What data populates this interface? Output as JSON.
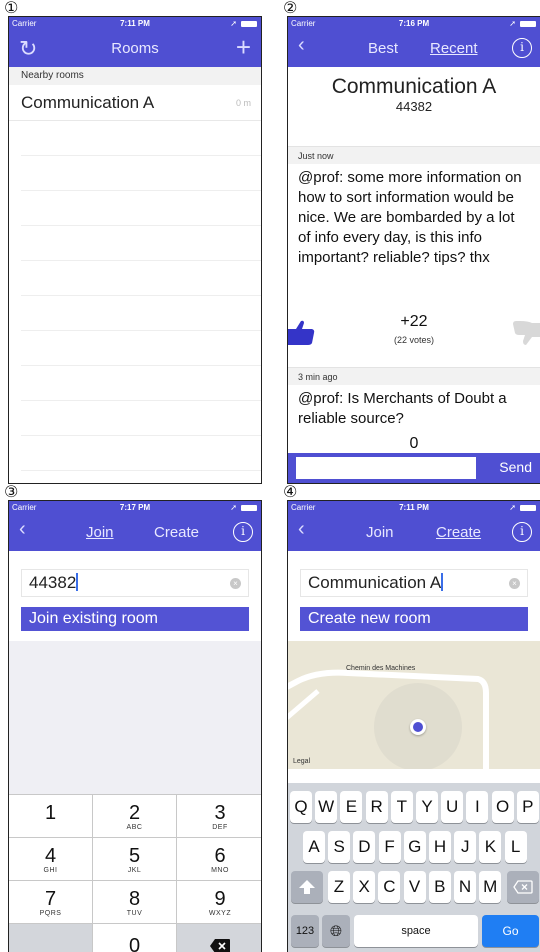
{
  "panels": {
    "p1": {
      "number": "①",
      "time": "7:11 PM",
      "title": "Rooms",
      "section": "Nearby rooms",
      "room": {
        "name": "Communication A",
        "distance": "0 m"
      }
    },
    "p2": {
      "number": "②",
      "time": "7:16 PM",
      "seg_best": "Best",
      "seg_recent": "Recent",
      "room_title": "Communication A",
      "room_code": "44382",
      "posts": [
        {
          "time": "Just now",
          "text": "@prof: some more information on how to sort information would be nice. We are bombarded by a lot of info every day, is this info important? reliable? tips? thx",
          "score": "+22",
          "votes": "(22 votes)"
        },
        {
          "time": "3 min ago",
          "text": "@prof: Is Merchants of Doubt a reliable source?",
          "score": "0"
        }
      ],
      "send_label": "Send"
    },
    "p3": {
      "number": "③",
      "time": "7:17 PM",
      "seg_join": "Join",
      "seg_create": "Create",
      "field_value": "44382",
      "action_label": "Join existing room",
      "keys": [
        {
          "d": "1",
          "l": ""
        },
        {
          "d": "2",
          "l": "ABC"
        },
        {
          "d": "3",
          "l": "DEF"
        },
        {
          "d": "4",
          "l": "GHI"
        },
        {
          "d": "5",
          "l": "JKL"
        },
        {
          "d": "6",
          "l": "MNO"
        },
        {
          "d": "7",
          "l": "PQRS"
        },
        {
          "d": "8",
          "l": "TUV"
        },
        {
          "d": "9",
          "l": "WXYZ"
        },
        {
          "d": "0",
          "l": ""
        }
      ]
    },
    "p4": {
      "number": "④",
      "time": "7:11 PM",
      "seg_join": "Join",
      "seg_create": "Create",
      "field_value": "Communication A",
      "action_label": "Create new room",
      "map_road": "Chemin des Machines",
      "map_legal": "Legal",
      "row1": [
        "Q",
        "W",
        "E",
        "R",
        "T",
        "Y",
        "U",
        "I",
        "O",
        "P"
      ],
      "row2": [
        "A",
        "S",
        "D",
        "F",
        "G",
        "H",
        "J",
        "K",
        "L"
      ],
      "row3": [
        "Z",
        "X",
        "C",
        "V",
        "B",
        "N",
        "M"
      ],
      "key_123": "123",
      "key_space": "space",
      "key_go": "Go"
    }
  },
  "carrier": "Carrier",
  "colors": {
    "accent": "#4f4fd2",
    "thumb": "#3434c8"
  }
}
